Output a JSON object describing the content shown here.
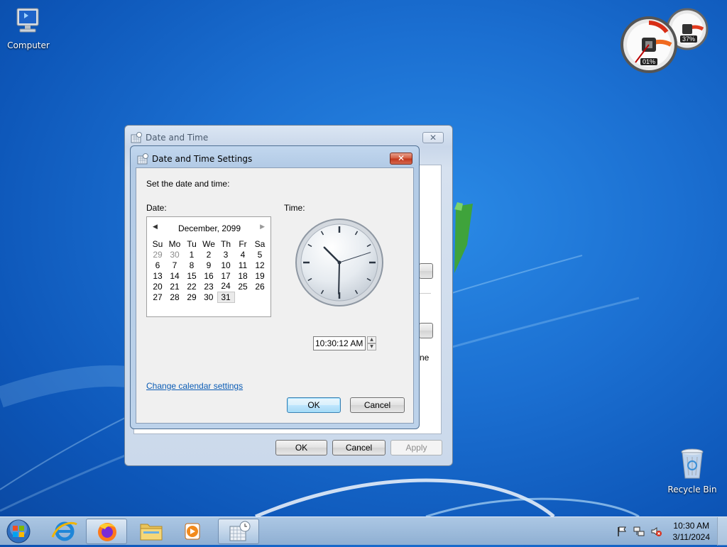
{
  "desktop": {
    "icons": [
      {
        "label": "Computer"
      },
      {
        "label": "Recycle Bin"
      }
    ],
    "gadget": {
      "cpu_label": "01%",
      "mem_label": "37%"
    }
  },
  "back_window": {
    "title": "Date and Time",
    "close_glyph": "✕",
    "partial_text": "ne",
    "buttons": {
      "ok": "OK",
      "cancel": "Cancel",
      "apply": "Apply"
    }
  },
  "dialog": {
    "title": "Date and Time Settings",
    "close_glyph": "✕",
    "prompt": "Set the date and time:",
    "date_label": "Date:",
    "time_label": "Time:",
    "calendar": {
      "month_label": "December, 2099",
      "prev_glyph": "◀",
      "next_glyph": "▶",
      "weekdays": [
        "Su",
        "Mo",
        "Tu",
        "We",
        "Th",
        "Fr",
        "Sa"
      ],
      "weeks": [
        [
          "29",
          "30",
          "1",
          "2",
          "3",
          "4",
          "5"
        ],
        [
          "6",
          "7",
          "8",
          "9",
          "10",
          "11",
          "12"
        ],
        [
          "13",
          "14",
          "15",
          "16",
          "17",
          "18",
          "19"
        ],
        [
          "20",
          "21",
          "22",
          "23",
          "24",
          "25",
          "26"
        ],
        [
          "27",
          "28",
          "29",
          "30",
          "31",
          "",
          ""
        ]
      ],
      "selected_day": "31"
    },
    "clock": {
      "hour": 10,
      "minute": 30,
      "second": 12
    },
    "time_value": "10:30:12 AM",
    "change_calendar_link": "Change calendar settings",
    "buttons": {
      "ok": "OK",
      "cancel": "Cancel"
    }
  },
  "taskbar": {
    "apps": [
      "start-orb",
      "internet-explorer",
      "firefox",
      "file-explorer",
      "media-player",
      "date-time-control-panel"
    ],
    "clock_time": "10:30 AM",
    "clock_date": "3/11/2024"
  },
  "colors": {
    "desktop": "#1b6fd1",
    "link": "#0b5cb5",
    "close_red": "#c2351a"
  }
}
